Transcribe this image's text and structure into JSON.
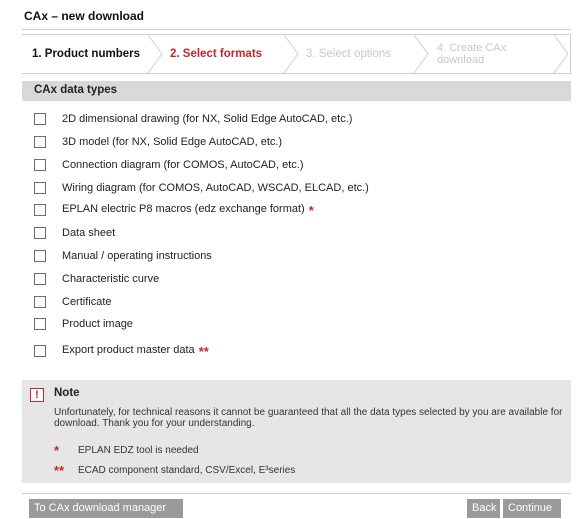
{
  "window": {
    "title": "CAx – new download"
  },
  "wizard": {
    "steps": [
      {
        "label": "1. Product numbers",
        "state": "done"
      },
      {
        "label": "2. Select formats",
        "state": "active"
      },
      {
        "label": "3. Select options",
        "state": "disabled"
      },
      {
        "label": "4. Create CAx download",
        "state": "disabled"
      }
    ]
  },
  "section": {
    "title": "CAx data types"
  },
  "options": [
    {
      "label": "2D dimensional drawing (for NX, Solid Edge AutoCAD, etc.)",
      "marker": "",
      "checked": false
    },
    {
      "label": "3D model (for NX, Solid Edge AutoCAD, etc.)",
      "marker": "",
      "checked": false
    },
    {
      "label": "Connection diagram (for COMOS, AutoCAD, etc.)",
      "marker": "",
      "checked": false
    },
    {
      "label": "Wiring diagram (for COMOS, AutoCAD, WSCAD, ELCAD, etc.)",
      "marker": "",
      "checked": false
    },
    {
      "label": "EPLAN electric P8 macros (edz exchange format)",
      "marker": "*",
      "checked": false
    },
    {
      "label": "Data sheet",
      "marker": "",
      "checked": false
    },
    {
      "label": "Manual / operating instructions",
      "marker": "",
      "checked": false
    },
    {
      "label": "Characteristic curve",
      "marker": "",
      "checked": false
    },
    {
      "label": "Certificate",
      "marker": "",
      "checked": false
    },
    {
      "label": "Product image",
      "marker": "",
      "checked": false
    },
    {
      "label": "Export product master data",
      "marker": "**",
      "checked": false
    }
  ],
  "note": {
    "icon": "!",
    "title": "Note",
    "text": "Unfortunately, for technical reasons it cannot be guaranteed that all the data types selected by you are available for download. Thank you for your understanding.",
    "footnotes": [
      {
        "marker": "*",
        "text": "EPLAN EDZ tool is needed"
      },
      {
        "marker": "**",
        "text": "ECAD component standard, CSV/Excel, E³series"
      }
    ]
  },
  "buttons": {
    "manager": "To CAx download manager",
    "back": "Back",
    "continue": "Continue"
  },
  "colors": {
    "accent": "#c0272d",
    "button": "#9a9a9a",
    "section_bg": "#d9d9d9",
    "note_bg": "#e6e6e6"
  }
}
